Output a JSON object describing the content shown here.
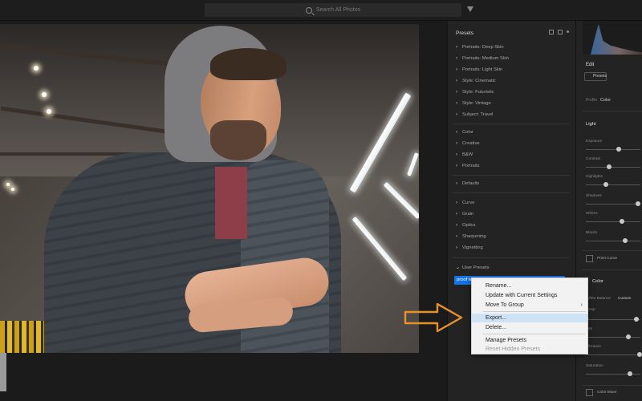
{
  "search": {
    "placeholder": "Search All Photos"
  },
  "presets_panel": {
    "title": "Presets",
    "groups": [
      [
        "Portraits: Deep Skin",
        "Portraits: Medium Skin",
        "Portraits: Light Skin",
        "Style: Cinematic",
        "Style: Futuristic",
        "Style: Vintage",
        "Subject: Travel"
      ],
      [
        "Color",
        "Creative",
        "B&W",
        "Portraits"
      ],
      [
        "Defaults"
      ],
      [
        "Curve",
        "Grain",
        "Optics",
        "Sharpening",
        "Vignetting"
      ],
      [
        "User Presets"
      ]
    ],
    "selected_preset": "proof test"
  },
  "context_menu": {
    "items": [
      "Rename...",
      "Update with Current Settings",
      "Move To Group",
      "Export...",
      "Delete...",
      "Manage Presets",
      "Reset Hidden Presets"
    ]
  },
  "edit_panel": {
    "title": "Edit",
    "presets_button": "Presets",
    "treatment_label": "Profile",
    "treatment_value": "Color",
    "light_section": "Light",
    "sliders": [
      "Exposure",
      "Contrast",
      "Highlights",
      "Shadows",
      "Whites",
      "Blacks"
    ],
    "point_curve": "Point Curve",
    "color_section": "Color",
    "white_balance_label": "White Balance",
    "white_balance_value": "Custom",
    "color_sliders": [
      "Temp",
      "Tint",
      "Vibrance",
      "Saturation"
    ],
    "color_mixer": "Color Mixer"
  },
  "colors": {
    "accent": "#1473e6",
    "arrow": "#e8902a",
    "menu_highlight": "#cfe3f7"
  }
}
